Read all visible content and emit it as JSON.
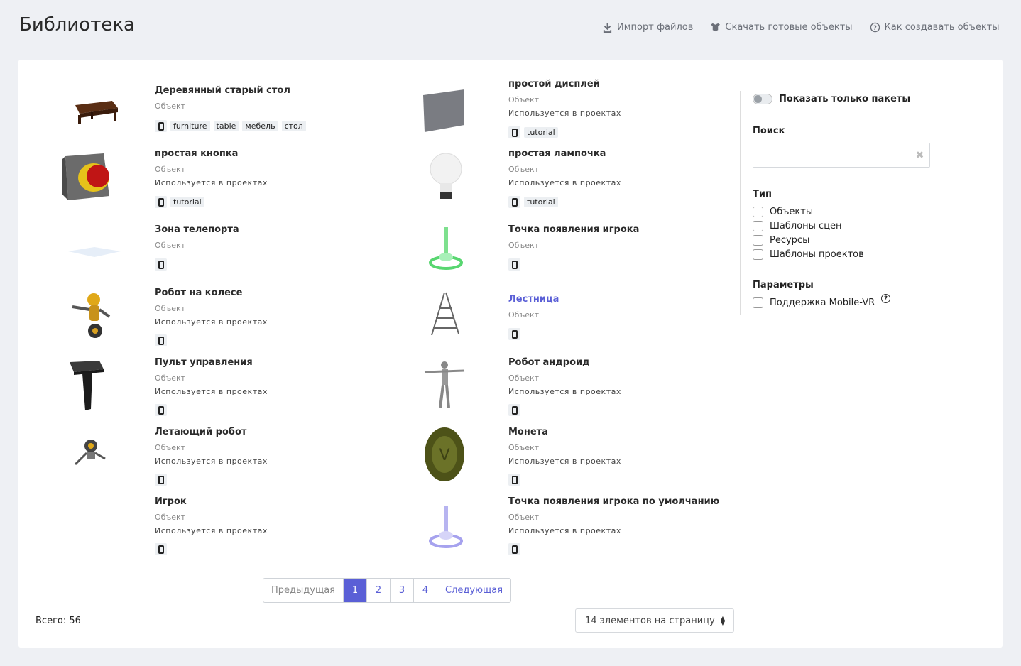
{
  "header": {
    "title": "Библиотека",
    "links": [
      {
        "label": "Импорт файлов",
        "icon": "download-icon"
      },
      {
        "label": "Скачать готовые объекты",
        "icon": "box-icon"
      },
      {
        "label": "Как создавать объекты",
        "icon": "question-circle-icon"
      }
    ]
  },
  "items": [
    {
      "name": "Деревянный старый стол",
      "type": "Объект",
      "used": "",
      "tags": [
        "furniture",
        "table",
        "мебель",
        "стол"
      ]
    },
    {
      "name": "простой дисплей",
      "type": "Объект",
      "used": "Используется в проектах",
      "tags": [
        "tutorial"
      ]
    },
    {
      "name": "простая кнопка",
      "type": "Объект",
      "used": "Используется в проектах",
      "tags": [
        "tutorial"
      ]
    },
    {
      "name": "простая лампочка",
      "type": "Объект",
      "used": "Используется в проектах",
      "tags": [
        "tutorial"
      ]
    },
    {
      "name": "Зона телепорта",
      "type": "Объект",
      "used": "",
      "tags": []
    },
    {
      "name": "Точка появления игрока",
      "type": "Объект",
      "used": "",
      "tags": []
    },
    {
      "name": "Робот на колесе",
      "type": "Объект",
      "used": "Используется в проектах",
      "tags": []
    },
    {
      "name": "Лестница",
      "type": "Объект",
      "used": "",
      "tags": []
    },
    {
      "name": "Пульт управления",
      "type": "Объект",
      "used": "Используется в проектах",
      "tags": []
    },
    {
      "name": "Робот андроид",
      "type": "Объект",
      "used": "Используется в проектах",
      "tags": []
    },
    {
      "name": "Летающий робот",
      "type": "Объект",
      "used": "Используется в проектах",
      "tags": []
    },
    {
      "name": "Монета",
      "type": "Объект",
      "used": "Используется в проектах",
      "tags": []
    },
    {
      "name": "Игрок",
      "type": "Объект",
      "used": "Используется в проектах",
      "tags": []
    },
    {
      "name": "Точка появления игрока по умолчанию",
      "type": "Объект",
      "used": "Используется в проектах",
      "tags": []
    }
  ],
  "sidebar": {
    "toggle_label": "Показать только пакеты",
    "search_title": "Поиск",
    "search_value": "",
    "type_title": "Тип",
    "type_options": [
      "Объекты",
      "Шаблоны сцен",
      "Ресурсы",
      "Шаблоны проектов"
    ],
    "params_title": "Параметры",
    "params_options": [
      "Поддержка Mobile-VR"
    ]
  },
  "pagination": {
    "prev": "Предыдущая",
    "pages": [
      "1",
      "2",
      "3",
      "4"
    ],
    "current": "1",
    "next": "Следующая"
  },
  "footer": {
    "total": "Всего: 56",
    "per_page": "14 элементов на страницу"
  },
  "colors": {
    "accent": "#5a5fd6",
    "background": "#eef0f4"
  }
}
